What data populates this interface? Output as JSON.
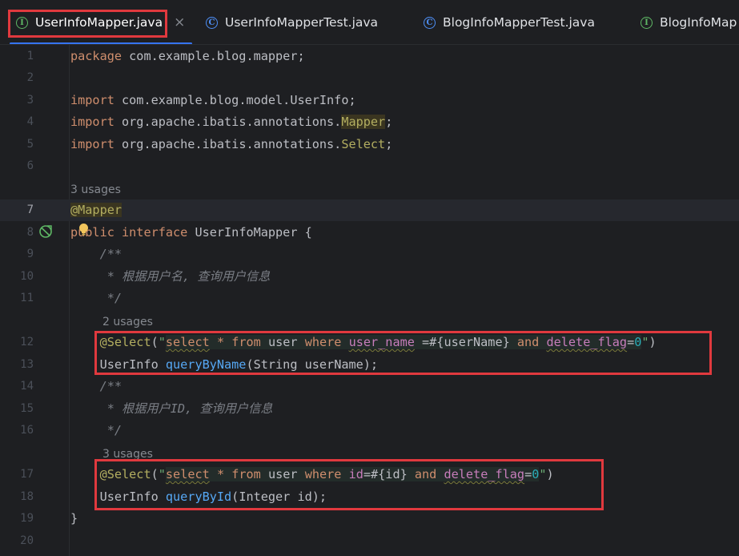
{
  "tabs": [
    {
      "label": "UserInfoMapper.java",
      "icon": "interface-icon",
      "icon_letter": "I",
      "active": true,
      "close": "×"
    },
    {
      "label": "UserInfoMapperTest.java",
      "icon": "class-icon",
      "icon_letter": "C",
      "active": false
    },
    {
      "label": "BlogInfoMapperTest.java",
      "icon": "class-icon",
      "icon_letter": "C",
      "active": false
    },
    {
      "label": "BlogInfoMap",
      "icon": "interface-icon",
      "icon_letter": "I",
      "active": false
    }
  ],
  "editor": {
    "hints": {
      "usages_interface": "3 usages",
      "usages_query_name": "2 usages",
      "usages_query_id": "3 usages"
    },
    "lines": [
      {
        "num": "1",
        "parts": [
          {
            "t": "package ",
            "c": "kw"
          },
          {
            "t": "com.example.blog.mapper;"
          }
        ]
      },
      {
        "num": "2",
        "parts": []
      },
      {
        "num": "3",
        "parts": [
          {
            "t": "import ",
            "c": "kw"
          },
          {
            "t": "com.example.blog.model.UserInfo;"
          }
        ]
      },
      {
        "num": "4",
        "parts": [
          {
            "t": "import ",
            "c": "kw"
          },
          {
            "t": "org.apache.ibatis.annotations."
          },
          {
            "t": "Mapper",
            "c": "ann mapper-hl"
          },
          {
            "t": ";"
          }
        ]
      },
      {
        "num": "5",
        "parts": [
          {
            "t": "import ",
            "c": "kw"
          },
          {
            "t": "org.apache.ibatis.annotations."
          },
          {
            "t": "Select",
            "c": "ann"
          },
          {
            "t": ";"
          }
        ]
      },
      {
        "num": "6",
        "parts": []
      },
      {
        "num": "7",
        "parts": [
          {
            "t": "@Mapper",
            "c": "ann mapper-hl"
          }
        ]
      },
      {
        "num": "8",
        "parts": [
          {
            "t": "public ",
            "c": "kw"
          },
          {
            "t": "interface ",
            "c": "kw"
          },
          {
            "t": "UserInfoMapper {"
          }
        ]
      },
      {
        "num": "9",
        "parts": [
          {
            "t": "    "
          },
          {
            "t": "/**",
            "c": "cmt"
          }
        ]
      },
      {
        "num": "10",
        "parts": [
          {
            "t": "    "
          },
          {
            "t": " * 根据用户名, 查询用户信息",
            "c": "cmt"
          }
        ]
      },
      {
        "num": "11",
        "parts": [
          {
            "t": "    "
          },
          {
            "t": " */",
            "c": "cmt"
          }
        ]
      },
      {
        "num": "12",
        "parts": [
          {
            "t": "    "
          },
          {
            "t": "@Select",
            "c": "ann"
          },
          {
            "t": "("
          },
          {
            "t": "\"",
            "c": "str"
          },
          {
            "t": "select",
            "c": "sqlkw inj wavy"
          },
          {
            "t": " ",
            "c": "inj"
          },
          {
            "t": "*",
            "c": "sqlkw inj"
          },
          {
            "t": " ",
            "c": "inj"
          },
          {
            "t": "from",
            "c": "sqlkw inj"
          },
          {
            "t": " user ",
            "c": "inj"
          },
          {
            "t": "where",
            "c": "sqlkw inj"
          },
          {
            "t": " ",
            "c": "inj"
          },
          {
            "t": "user_name",
            "c": "sqlcol inj wavy"
          },
          {
            "t": " =#{userName} ",
            "c": "inj"
          },
          {
            "t": "and",
            "c": "sqlkw inj"
          },
          {
            "t": " ",
            "c": "inj"
          },
          {
            "t": "delete_flag",
            "c": "sqlcol inj wavy"
          },
          {
            "t": "=",
            "c": "inj"
          },
          {
            "t": "0",
            "c": "num inj"
          },
          {
            "t": "\"",
            "c": "str"
          },
          {
            "t": ")"
          }
        ]
      },
      {
        "num": "13",
        "parts": [
          {
            "t": "    UserInfo "
          },
          {
            "t": "queryByName",
            "c": "fn"
          },
          {
            "t": "(String userName);"
          }
        ]
      },
      {
        "num": "14",
        "parts": [
          {
            "t": "    "
          },
          {
            "t": "/**",
            "c": "cmt"
          }
        ]
      },
      {
        "num": "15",
        "parts": [
          {
            "t": "    "
          },
          {
            "t": " * 根据用户ID, 查询用户信息",
            "c": "cmt"
          }
        ]
      },
      {
        "num": "16",
        "parts": [
          {
            "t": "    "
          },
          {
            "t": " */",
            "c": "cmt"
          }
        ]
      },
      {
        "num": "17",
        "parts": [
          {
            "t": "    "
          },
          {
            "t": "@Select",
            "c": "ann"
          },
          {
            "t": "("
          },
          {
            "t": "\"",
            "c": "str"
          },
          {
            "t": "select",
            "c": "sqlkw inj wavy"
          },
          {
            "t": " ",
            "c": "inj"
          },
          {
            "t": "*",
            "c": "sqlkw inj"
          },
          {
            "t": " ",
            "c": "inj"
          },
          {
            "t": "from",
            "c": "sqlkw inj"
          },
          {
            "t": " user ",
            "c": "inj"
          },
          {
            "t": "where",
            "c": "sqlkw inj"
          },
          {
            "t": " ",
            "c": "inj"
          },
          {
            "t": "id",
            "c": "sqlcol inj"
          },
          {
            "t": "=#{id} ",
            "c": "inj"
          },
          {
            "t": "and",
            "c": "sqlkw inj"
          },
          {
            "t": " ",
            "c": "inj"
          },
          {
            "t": "delete_flag",
            "c": "sqlcol inj wavy"
          },
          {
            "t": "=",
            "c": "inj"
          },
          {
            "t": "0",
            "c": "num inj"
          },
          {
            "t": "\"",
            "c": "str"
          },
          {
            "t": ")"
          }
        ]
      },
      {
        "num": "18",
        "parts": [
          {
            "t": "    UserInfo "
          },
          {
            "t": "queryById",
            "c": "fn"
          },
          {
            "t": "(Integer id);"
          }
        ]
      },
      {
        "num": "19",
        "parts": [
          {
            "t": "}"
          }
        ]
      },
      {
        "num": "20",
        "parts": []
      }
    ]
  },
  "colors": {
    "background": "#1e1f22",
    "keyword": "#cf8e6d",
    "annotation": "#b3ae60",
    "comment": "#7a7e85",
    "string": "#6aab73",
    "method": "#56a8f5",
    "number": "#2aacb8",
    "sql_column": "#c77dbb",
    "highlight_box": "#e0393e",
    "active_tab_underline": "#3574f0"
  }
}
